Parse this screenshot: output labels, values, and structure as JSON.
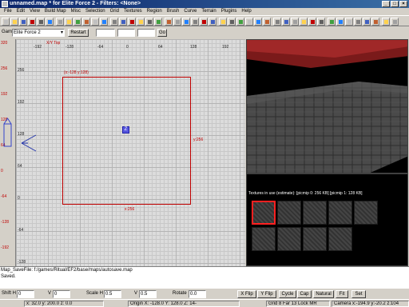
{
  "window": {
    "title": "unnamed.map * for Elite Force 2 - Filters: <None>"
  },
  "menu": [
    "File",
    "Edit",
    "View",
    "Build Map",
    "Misc",
    "Selection",
    "Grid",
    "Textures",
    "Region",
    "Brush",
    "Curve",
    "Terrain",
    "Plugins",
    "Help"
  ],
  "game_row": {
    "label": "Game",
    "game_value": "Elite Force 2",
    "restart_label": "Restart",
    "go_label": "Go"
  },
  "view2d": {
    "ruler_z": [
      "320",
      "256",
      "192",
      "128",
      "64",
      "0",
      "-64",
      "-128",
      "-192"
    ],
    "ruler_x": [
      "-192",
      "-128",
      "-64",
      "0",
      "64",
      "128",
      "192"
    ],
    "ruler_y": [
      "256",
      "192",
      "128",
      "64",
      "0",
      "-64",
      "-128",
      "-192"
    ],
    "view_label": "X/Y Top",
    "corner_label": "(x:-128 y:128)",
    "width_label": "x:256",
    "height_label": "y:256",
    "origin_glyph": "Z"
  },
  "textures": {
    "header": "Textures in use (estimate): [picmip 0: 256 KB] [picmip 1: 128 KB]",
    "tiles": 9
  },
  "console": {
    "lines": [
      "Map_SaveFile: f:/games/Ritual/EF2/base/maps/autosave.map",
      "Saved."
    ]
  },
  "bottom": {
    "shift_h_label": "Shift H",
    "shift_h_value": "0",
    "shift_v_label": "V",
    "shift_v_value": "0",
    "scale_h_label": "Scale H",
    "scale_h_value": "0.5",
    "scale_v_label": "V",
    "scale_v_value": "0.5",
    "rotate_label": "Rotate",
    "rotate_value": "0.0",
    "buttons": [
      "X Flip",
      "Y Flip",
      "Cycle",
      "Cap",
      "Natural",
      "Fit",
      "Set"
    ]
  },
  "status": {
    "coords": "x: 32.0  y: 200.0  z: 0.0",
    "origin": "Origin X: -128.0  Y: 128.0  Z: 14-",
    "grid": "Grid 8 Far 13 Lock MR",
    "camera": "Camera x:-194.9 y:-20.2 z:104"
  },
  "colors": {
    "brush": "#c00000",
    "titlebar": "#0a246a",
    "grid_bg": "#dcdcdc"
  }
}
